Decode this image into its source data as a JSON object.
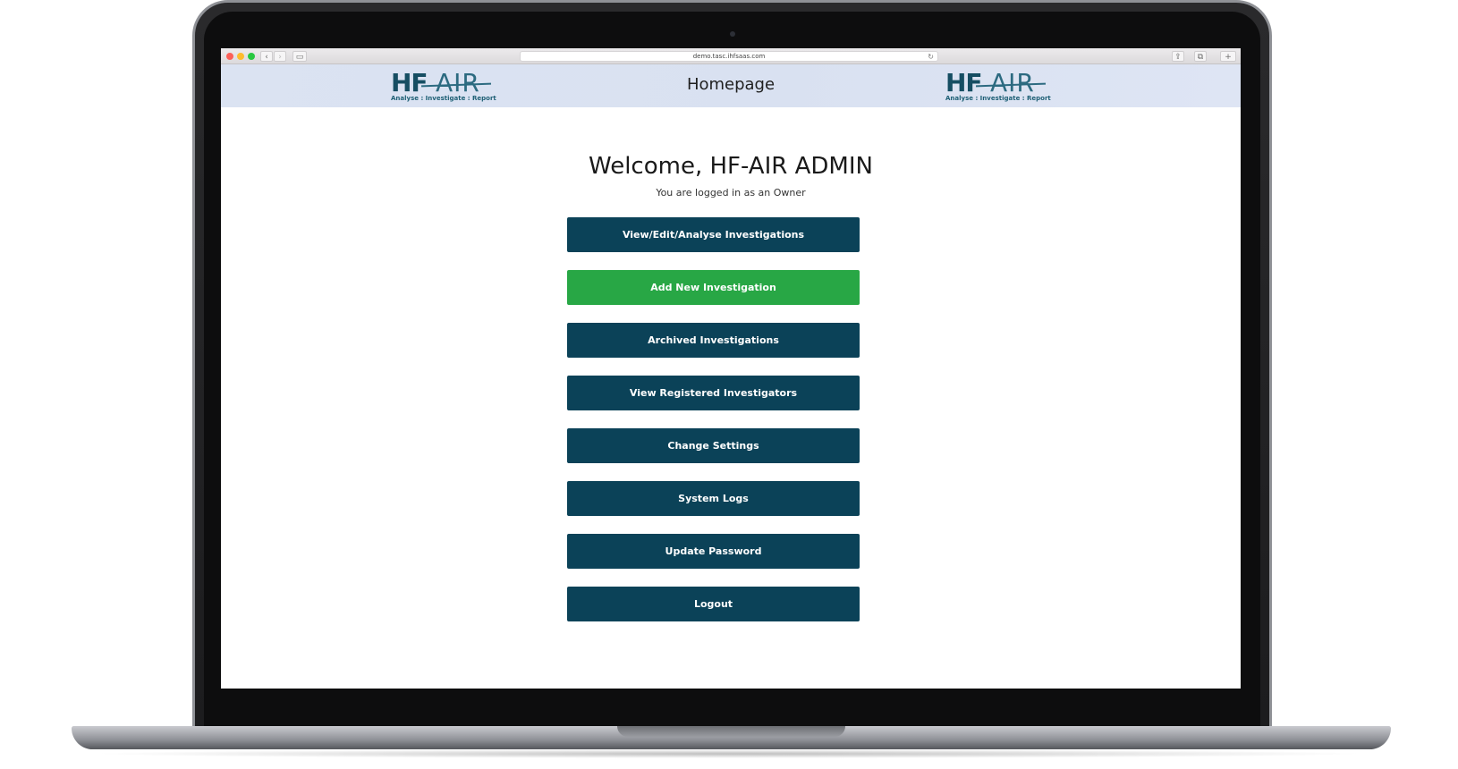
{
  "browser": {
    "url": "demo.tasc.ihfsaas.com",
    "back_icon": "chevron-left-icon",
    "forward_icon": "chevron-right-icon",
    "reload_icon": "reload-icon"
  },
  "header": {
    "title": "Homepage",
    "logo": {
      "hf": "HF",
      "air": "AIR",
      "tagline": "Analyse : Investigate : Report"
    }
  },
  "main": {
    "welcome": "Welcome, HF-AIR ADMIN",
    "role_text": "You are logged in as an Owner",
    "buttons": [
      {
        "label": "View/Edit/Analyse Investigations"
      },
      {
        "label": "Add New Investigation"
      },
      {
        "label": "Archived Investigations"
      },
      {
        "label": "View Registered Investigators"
      },
      {
        "label": "Change Settings"
      },
      {
        "label": "System Logs"
      },
      {
        "label": "Update Password"
      },
      {
        "label": "Logout"
      }
    ]
  },
  "colors": {
    "primary_button": "#0b4258",
    "accent_button": "#28a745",
    "header_bg": "#dbe3f2"
  }
}
